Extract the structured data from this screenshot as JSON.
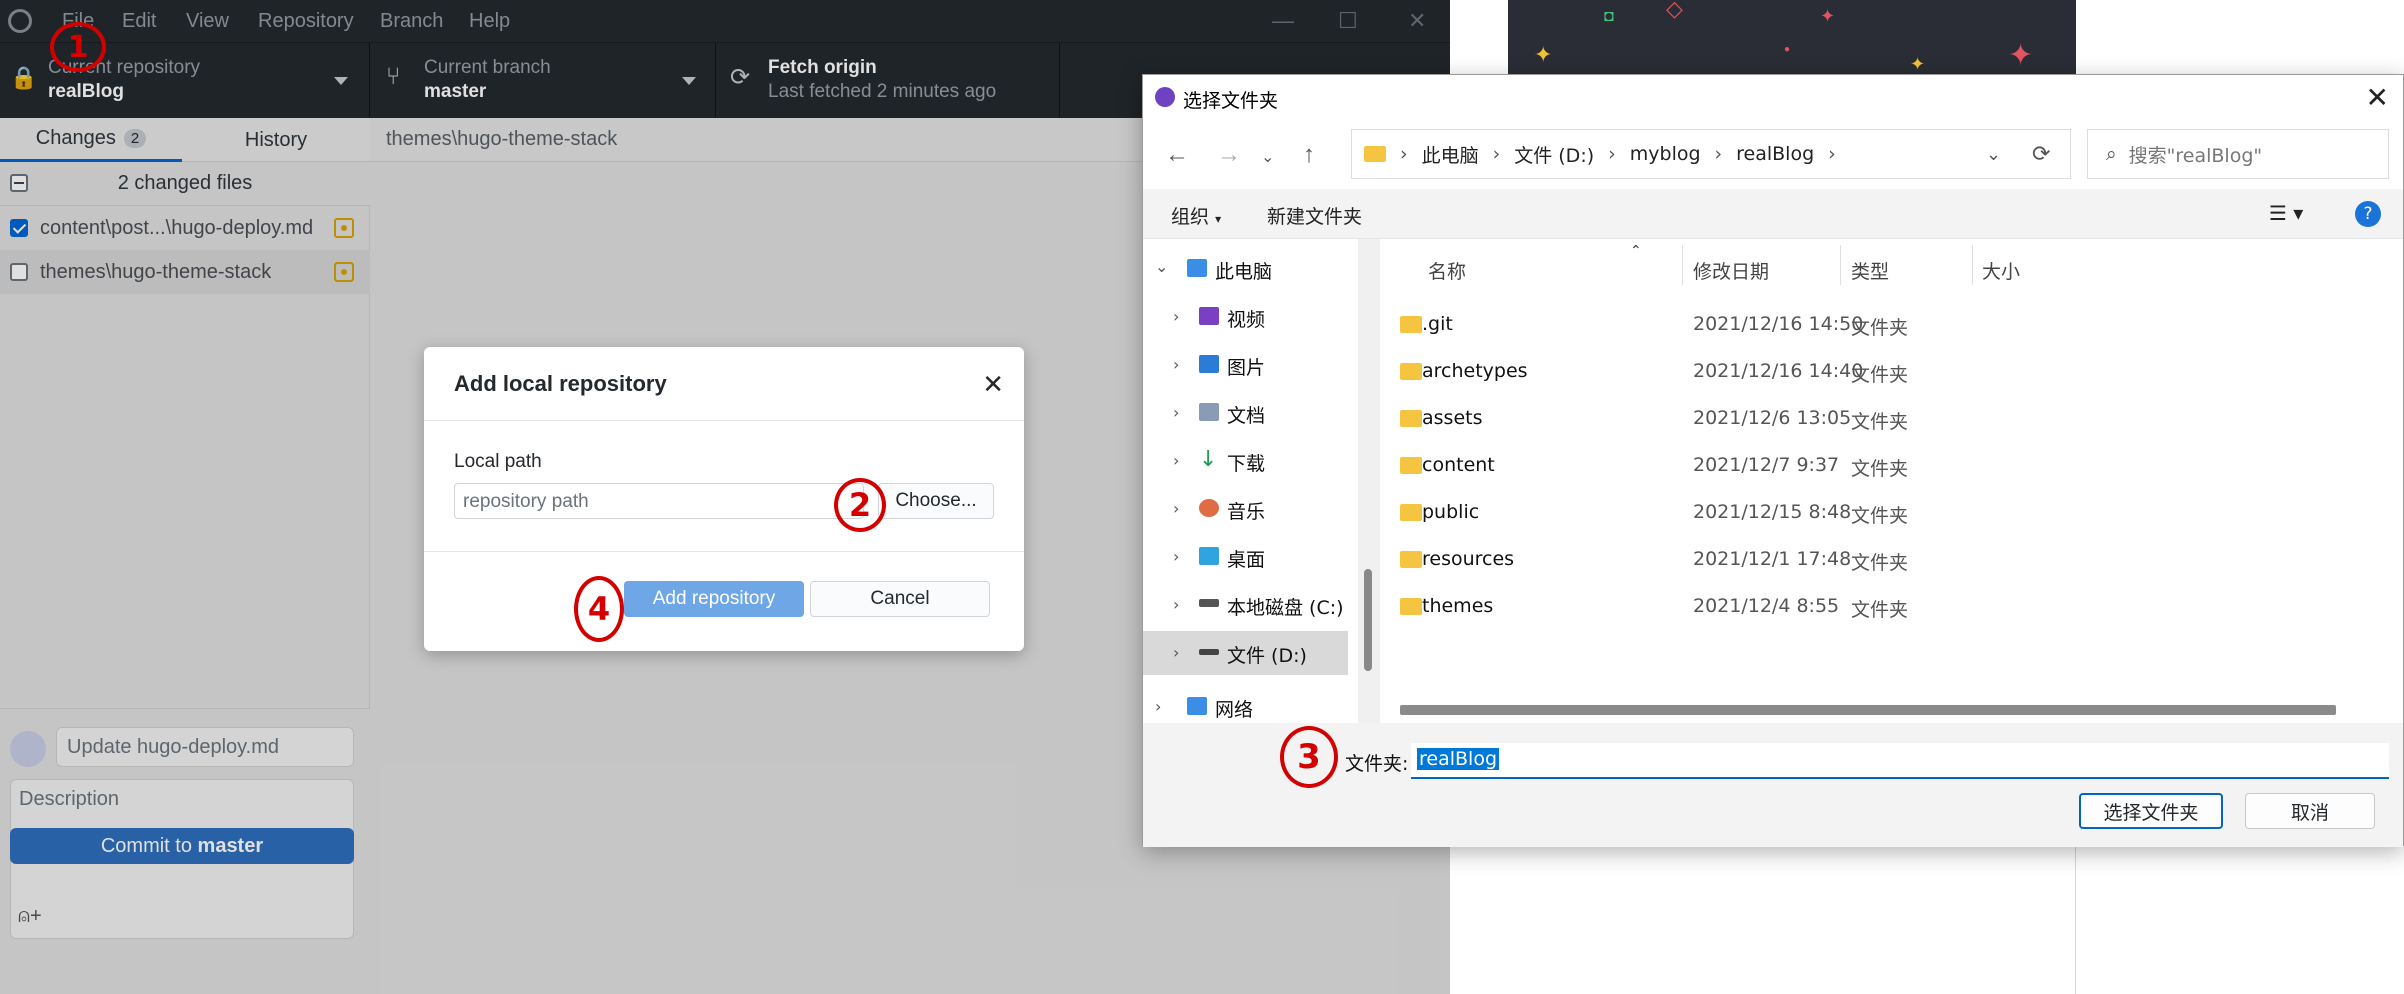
{
  "ghd": {
    "menu": [
      "File",
      "Edit",
      "View",
      "Repository",
      "Branch",
      "Help"
    ],
    "toolbar": {
      "repo_label": "Current repository",
      "repo_value": "realBlog",
      "branch_label": "Current branch",
      "branch_value": "master",
      "fetch_label": "Fetch origin",
      "fetch_sub": "Last fetched 2 minutes ago"
    },
    "tabs": {
      "changes": "Changes",
      "changes_count": "2",
      "history": "History"
    },
    "changed_files_header": "2 changed files",
    "files": [
      {
        "name": "content\\post...\\hugo-deploy.md",
        "checked": true
      },
      {
        "name": "themes\\hugo-theme-stack",
        "checked": false
      }
    ],
    "path_bar": "themes\\hugo-theme-stack",
    "commit": {
      "summary": "Update hugo-deploy.md",
      "description_placeholder": "Description",
      "button_prefix": "Commit to ",
      "button_branch": "master"
    },
    "dialog": {
      "title": "Add local repository",
      "local_path_label": "Local path",
      "path_placeholder": "repository path",
      "choose": "Choose...",
      "add": "Add repository",
      "cancel": "Cancel"
    }
  },
  "picker": {
    "title": "选择文件夹",
    "breadcrumb": [
      "此电脑",
      "文件 (D:)",
      "myblog",
      "realBlog"
    ],
    "search_placeholder": "搜索\"realBlog\"",
    "organize": "组织",
    "new_folder": "新建文件夹",
    "columns": {
      "name": "名称",
      "date": "修改日期",
      "type": "类型",
      "size": "大小"
    },
    "nav": [
      {
        "label": "此电脑",
        "icon": "pc-icon"
      },
      {
        "label": "视频",
        "icon": "video-icon"
      },
      {
        "label": "图片",
        "icon": "pictures-icon"
      },
      {
        "label": "文档",
        "icon": "documents-icon"
      },
      {
        "label": "下载",
        "icon": "download-icon"
      },
      {
        "label": "音乐",
        "icon": "music-icon"
      },
      {
        "label": "桌面",
        "icon": "desktop-icon"
      },
      {
        "label": "本地磁盘 (C:)",
        "icon": "drive-icon"
      },
      {
        "label": "文件 (D:)",
        "icon": "drive-icon"
      },
      {
        "label": "网络",
        "icon": "network-icon"
      }
    ],
    "files": [
      {
        "name": ".git",
        "date": "2021/12/16 14:50",
        "type": "文件夹"
      },
      {
        "name": "archetypes",
        "date": "2021/12/16 14:40",
        "type": "文件夹"
      },
      {
        "name": "assets",
        "date": "2021/12/6 13:05",
        "type": "文件夹"
      },
      {
        "name": "content",
        "date": "2021/12/7 9:37",
        "type": "文件夹"
      },
      {
        "name": "public",
        "date": "2021/12/15 8:48",
        "type": "文件夹"
      },
      {
        "name": "resources",
        "date": "2021/12/1 17:48",
        "type": "文件夹"
      },
      {
        "name": "themes",
        "date": "2021/12/4 8:55",
        "type": "文件夹"
      }
    ],
    "folder_label": "文件夹:",
    "folder_value": "realBlog",
    "select_button": "选择文件夹",
    "cancel_button": "取消"
  },
  "annotations": [
    "1",
    "2",
    "3",
    "4"
  ]
}
